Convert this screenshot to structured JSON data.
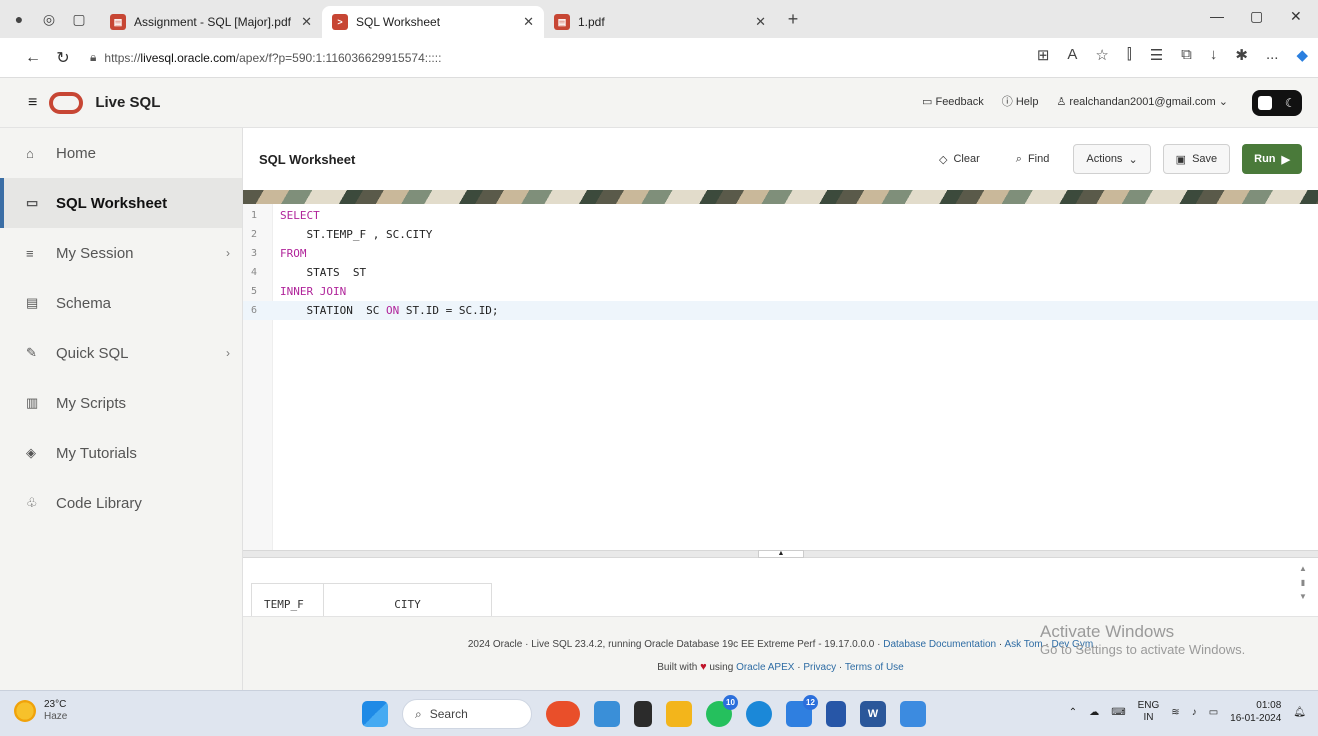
{
  "browser": {
    "tabs": [
      {
        "title": "Assignment - SQL [Major].pdf",
        "icon": "pdf-icon"
      },
      {
        "title": "SQL Worksheet",
        "icon": "sql-icon"
      },
      {
        "title": "1.pdf",
        "icon": "pdf-icon"
      }
    ],
    "active_tab": 1,
    "url_prefix": "https://",
    "url_host": "livesql.oracle.com",
    "url_path": "/apex/f?p=590:1:116036629915574:::::",
    "new_tab": "+",
    "menu": "..."
  },
  "header": {
    "brand": "Live SQL",
    "feedback": "Feedback",
    "help": "Help",
    "user": "realchandan2001@gmail.com"
  },
  "sidebar": {
    "items": [
      {
        "label": "Home",
        "icon": "home-icon",
        "glyph": "⌂"
      },
      {
        "label": "SQL Worksheet",
        "icon": "worksheet-icon",
        "glyph": "▭"
      },
      {
        "label": "My Session",
        "icon": "session-icon",
        "glyph": "≡"
      },
      {
        "label": "Schema",
        "icon": "schema-icon",
        "glyph": "▤"
      },
      {
        "label": "Quick SQL",
        "icon": "quick-sql-icon",
        "glyph": "✎"
      },
      {
        "label": "My Scripts",
        "icon": "scripts-icon",
        "glyph": "▥"
      },
      {
        "label": "My Tutorials",
        "icon": "tutorials-icon",
        "glyph": "◈"
      },
      {
        "label": "Code Library",
        "icon": "code-library-icon",
        "glyph": "♧"
      }
    ]
  },
  "worksheet": {
    "title": "SQL Worksheet",
    "clear": "Clear",
    "find": "Find",
    "actions": "Actions",
    "save": "Save",
    "run": "Run"
  },
  "editor": {
    "lines": [
      {
        "n": "1",
        "text": "SELECT"
      },
      {
        "n": "2",
        "text": "    ST.TEMP_F , SC.CITY"
      },
      {
        "n": "3",
        "text": "FROM"
      },
      {
        "n": "4",
        "text": "    STATS  ST"
      },
      {
        "n": "5",
        "text": "INNER JOIN"
      },
      {
        "n": "6",
        "text": "    STATION  SC ON ST.ID = SC.ID;"
      }
    ],
    "active_line": 6
  },
  "results": {
    "columns": [
      "TEMP_F",
      "CITY"
    ]
  },
  "footer": {
    "line1": "2024 Oracle · Live SQL 23.4.2, running Oracle Database 19c EE Extreme Perf - 19.17.0.0.0 · ",
    "doc_link": "Database Documentation",
    "sep1": " · ",
    "asktom": "Ask Tom",
    "sep2": " · ",
    "devgym": "Dev Gym",
    "built_with": "Built with",
    "using": "using",
    "apex": "Oracle APEX",
    "sep3": " · ",
    "privacy": "Privacy",
    "sep4": " · ",
    "terms": "Terms of Use"
  },
  "watermark": {
    "line1": "Activate Windows",
    "line2": "Go to Settings to activate Windows."
  },
  "taskbar": {
    "temp": "23°C",
    "weather": "Haze",
    "search": "Search",
    "badge_whatsapp": "10",
    "badge_app": "12",
    "lang1": "ENG",
    "lang2": "IN",
    "time": "01:08",
    "date": "16-01-2024"
  }
}
